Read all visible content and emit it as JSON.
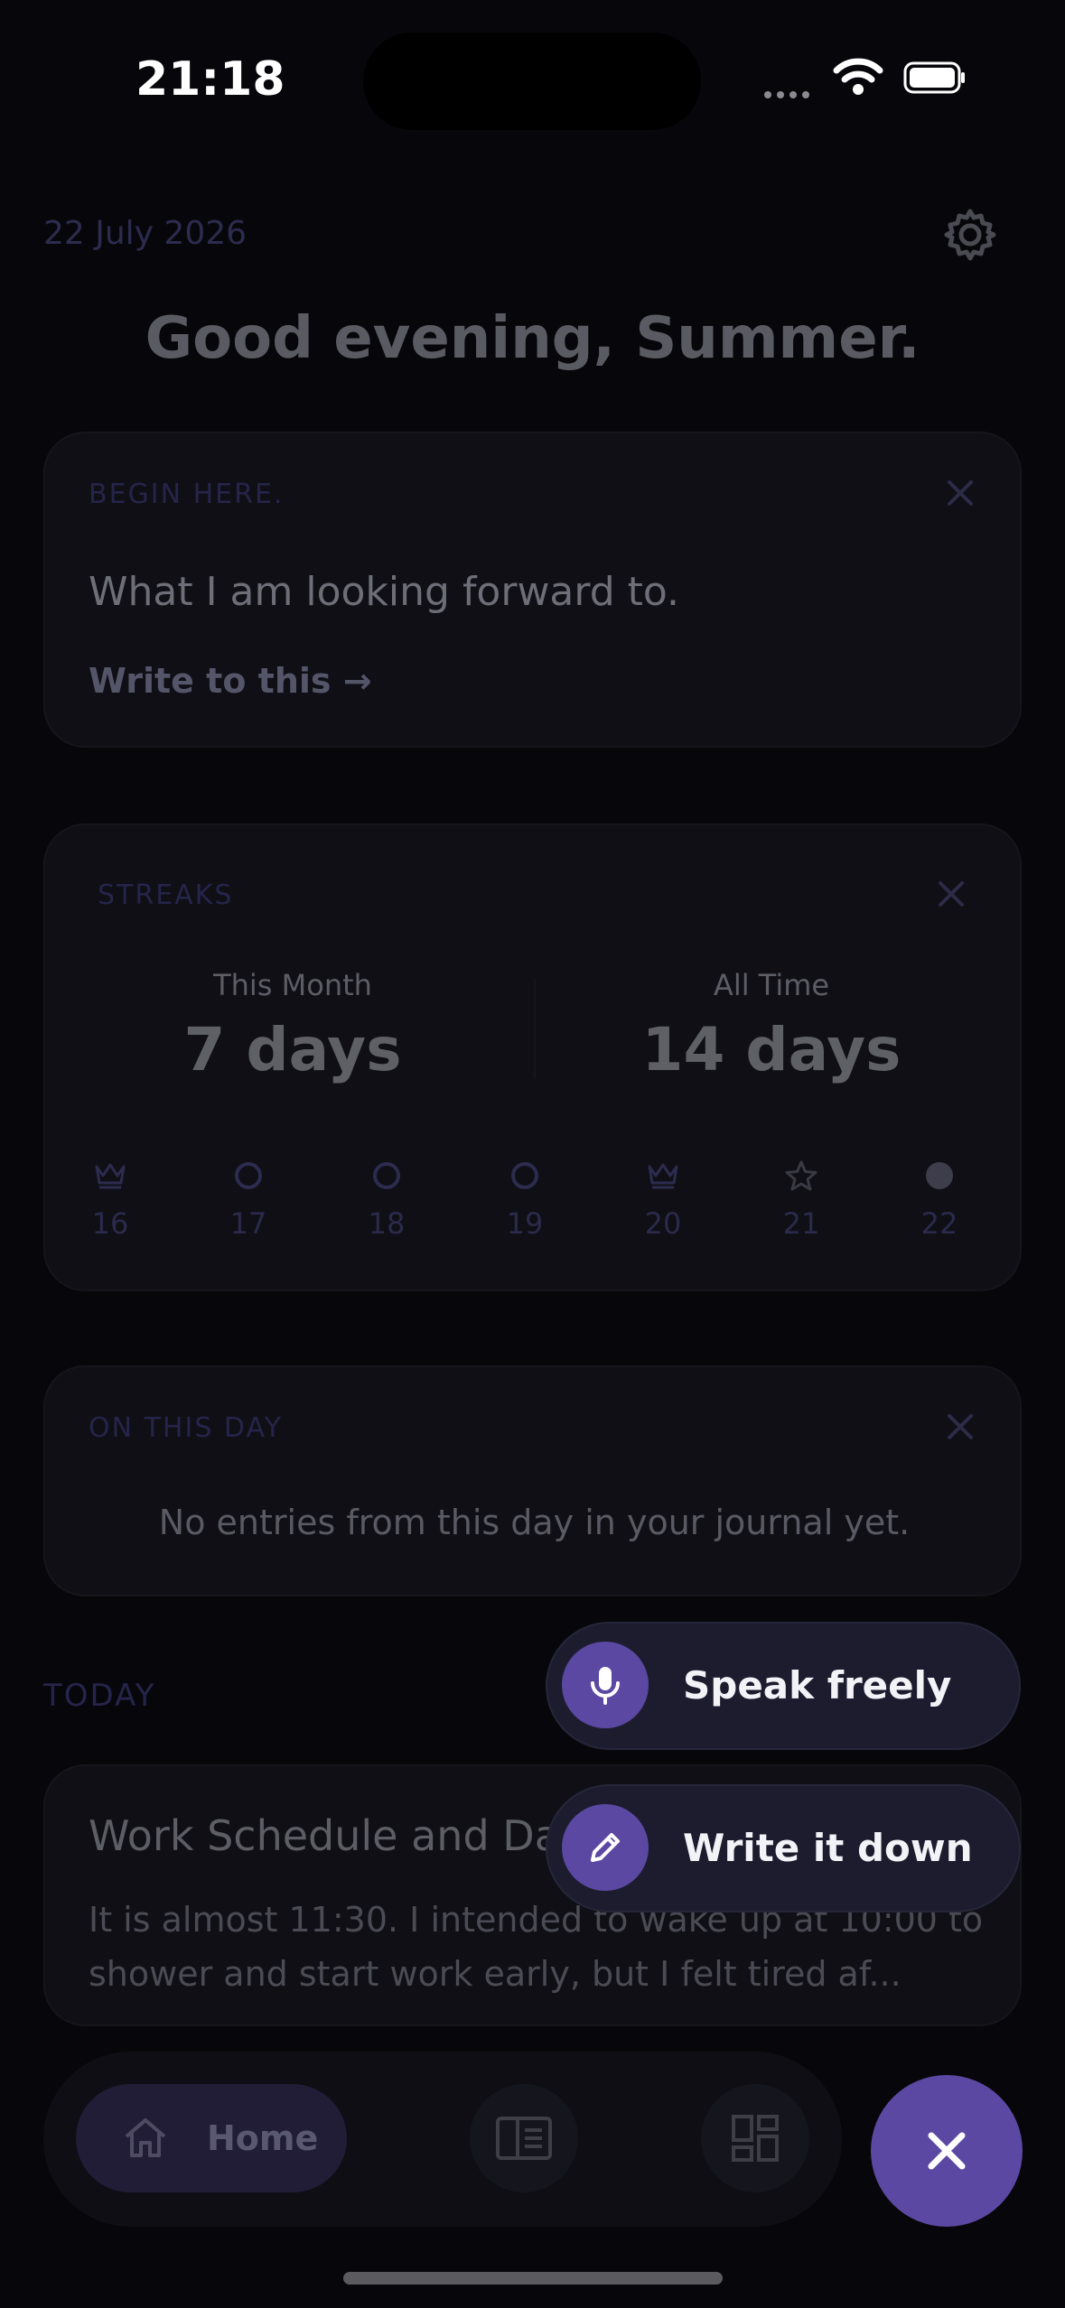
{
  "status": {
    "time": "21:18"
  },
  "header": {
    "date": "22 July 2026",
    "greeting": "Good evening, Summer."
  },
  "prompt_card": {
    "label": "BEGIN HERE.",
    "prompt": "What I am looking forward to.",
    "action": "Write to this →"
  },
  "streaks": {
    "label": "STREAKS",
    "this_month_label": "This Month",
    "this_month_value": "7 days",
    "all_time_label": "All Time",
    "all_time_value": "14 days",
    "days": [
      {
        "num": "16",
        "icon": "crown-icon"
      },
      {
        "num": "17",
        "icon": "circle-outline-icon"
      },
      {
        "num": "18",
        "icon": "circle-outline-icon"
      },
      {
        "num": "19",
        "icon": "circle-outline-icon"
      },
      {
        "num": "20",
        "icon": "crown-icon"
      },
      {
        "num": "21",
        "icon": "star-icon"
      },
      {
        "num": "22",
        "icon": "circle-filled-icon"
      }
    ]
  },
  "on_this_day": {
    "label": "ON THIS DAY",
    "text": "No entries from this day in your journal yet."
  },
  "today": {
    "label": "TODAY",
    "entry_title": "Work Schedule and Da",
    "entry_body": "It is almost 11:30. I intended to wake up at 10:00 to shower and start work early, but I felt tired af..."
  },
  "fab_menu": {
    "speak": "Speak freely",
    "write": "Write it down"
  },
  "tabbar": {
    "home": "Home"
  },
  "colors": {
    "accent": "#5b48a2",
    "background": "#07070b",
    "card": "#0f0f15"
  }
}
